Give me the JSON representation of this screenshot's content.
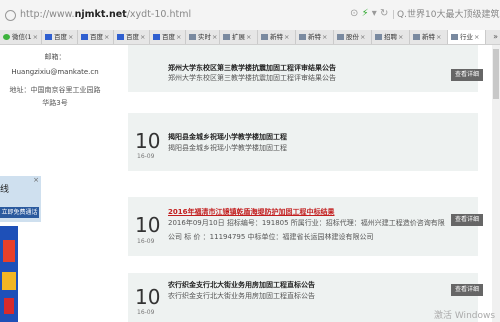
{
  "address_bar": {
    "scheme": "http://",
    "host_prefix": "www.",
    "host": "njmkt.net",
    "path": "/xydt-10.html",
    "search_placeholder": "Q.世界10大最大顶级建筑"
  },
  "tabs": [
    {
      "label": "微信(1",
      "icon": "wechat-icon"
    },
    {
      "label": "百度",
      "icon": "baidu-icon"
    },
    {
      "label": "百度",
      "icon": "baidu-icon"
    },
    {
      "label": "百度",
      "icon": "baidu-icon"
    },
    {
      "label": "百度",
      "icon": "baidu-icon"
    },
    {
      "label": "实时",
      "icon": "page-icon"
    },
    {
      "label": "扩展",
      "icon": "page-icon"
    },
    {
      "label": "新特",
      "icon": "page-icon"
    },
    {
      "label": "新特",
      "icon": "page-icon"
    },
    {
      "label": "股份",
      "icon": "page-icon"
    },
    {
      "label": "招聘",
      "icon": "page-icon"
    },
    {
      "label": "新特",
      "icon": "page-icon"
    },
    {
      "label": "行业",
      "icon": "page-icon",
      "active": true
    }
  ],
  "tab_close": "×",
  "tab_scroll": "»",
  "contact": {
    "email_label": "邮箱：",
    "email": "Huangzixiu@mankate.cn",
    "address_line1": "地址：中国南京谷里工业园路",
    "address_line2": "华路3号"
  },
  "float_widget": {
    "text": "线",
    "button": "立即免费通话",
    "close": "×"
  },
  "news": [
    {
      "day": "10",
      "month": "16-09",
      "title": "郑州大学东校区第三教学楼抗震加固工程评审结果公告",
      "summary": [
        "郑州大学东校区第三教学楼抗震加固工程评审结果公告"
      ],
      "button": "查看详细",
      "highlight": false
    },
    {
      "day": "10",
      "month": "16-09",
      "title": "揭阳县金城乡祝瑶小学教学楼加固工程",
      "summary": [
        "揭阳县金城乡祝瑶小学教学楼加固工程"
      ],
      "button": "查看详细",
      "highlight": false
    },
    {
      "day": "10",
      "month": "16-09",
      "title": "2016年福清市江镜镇乾盾海堤防护加固工程中标结果",
      "summary": [
        "2016年09月10日 招标编号：191805 所属行业：招标代理：福州兴建工程造价咨询有限",
        "公司 标 价 ：11194795 中标单位：福建省长运园林建设有限公司"
      ],
      "button": "查看详细",
      "highlight": true
    },
    {
      "day": "10",
      "month": "16-09",
      "title": "农行织金支行北大街业务用房加固工程直标公告",
      "summary": [
        "农行织金支行北大街业务用房加固工程直标公告"
      ],
      "button": "查看详细",
      "highlight": false
    }
  ],
  "watermark": "激活 Windows"
}
